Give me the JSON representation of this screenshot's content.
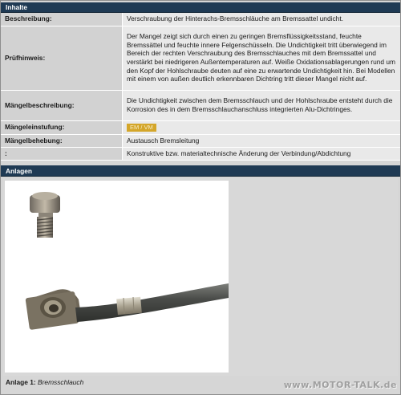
{
  "inhalte": {
    "title": "Inhalte",
    "rows": [
      {
        "label": "Beschreibung:",
        "value": "Verschraubung der Hinterachs-Bremsschläuche am Bremssattel undicht."
      },
      {
        "label": "Prüfhinweis:",
        "value": "Der Mangel zeigt sich durch einen zu geringen Bremsflüssigkeitsstand, feuchte Bremssättel und feuchte innere Felgenschüsseln. Die Undichtigkeit tritt überwiegend im Bereich der rechten Verschraubung des Bremsschlauches mit dem Bremssattel und verstärkt bei niedrigeren Außentemperaturen auf. Weiße Oxidationsablagerungen rund um den Kopf der Hohlschraube deuten auf eine zu erwartende Undichtigkeit hin. Bei Modellen mit einem von außen deutlich erkennbaren Dichtring tritt dieser Mangel nicht auf."
      },
      {
        "label": "Mängelbeschreibung:",
        "value": "Die Undichtigkeit zwischen dem Bremsschlauch und der Hohlschraube entsteht durch die Korrosion des in dem Bremsschlauchanschluss integrierten Alu-Dichtringes."
      },
      {
        "label": "Mängeleinstufung:",
        "value": "EM / VM"
      },
      {
        "label": "Mängelbehebung:",
        "value": "Austausch Bremsleitung"
      },
      {
        "label": ":",
        "value": "Konstruktive bzw. materialtechnische Änderung der Verbindung/Abdichtung"
      }
    ]
  },
  "anlagen": {
    "title": "Anlagen",
    "caption_label": "Anlage 1:",
    "caption_text": "Bremsschlauch"
  },
  "watermark": "www.MOTOR-TALK.de",
  "colors": {
    "header_bg": "#1f3a54",
    "badge_bg": "#d4a62a"
  }
}
